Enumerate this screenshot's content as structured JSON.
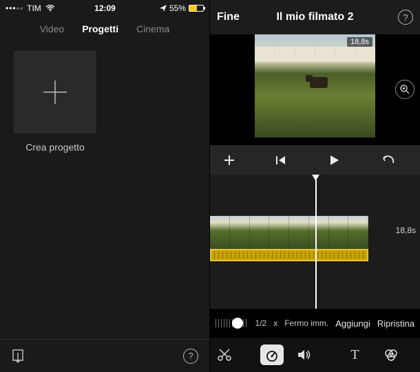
{
  "status": {
    "carrier": "TIM",
    "time": "12:09",
    "battery_pct": "55%"
  },
  "left": {
    "tabs": {
      "video": "Video",
      "progetti": "Progetti",
      "cinema": "Cinema"
    },
    "create_label": "Crea progetto"
  },
  "right": {
    "done": "Fine",
    "title": "Il mio filmato 2",
    "clip_duration": "18,8s",
    "timeline_time": "18,8s",
    "speed": {
      "ratio": "1/2",
      "x": "x",
      "freeze": "Fermo imm.",
      "add": "Aggiungi",
      "reset": "Ripristina"
    }
  },
  "icons": {
    "help": "?",
    "text_tool": "T"
  }
}
